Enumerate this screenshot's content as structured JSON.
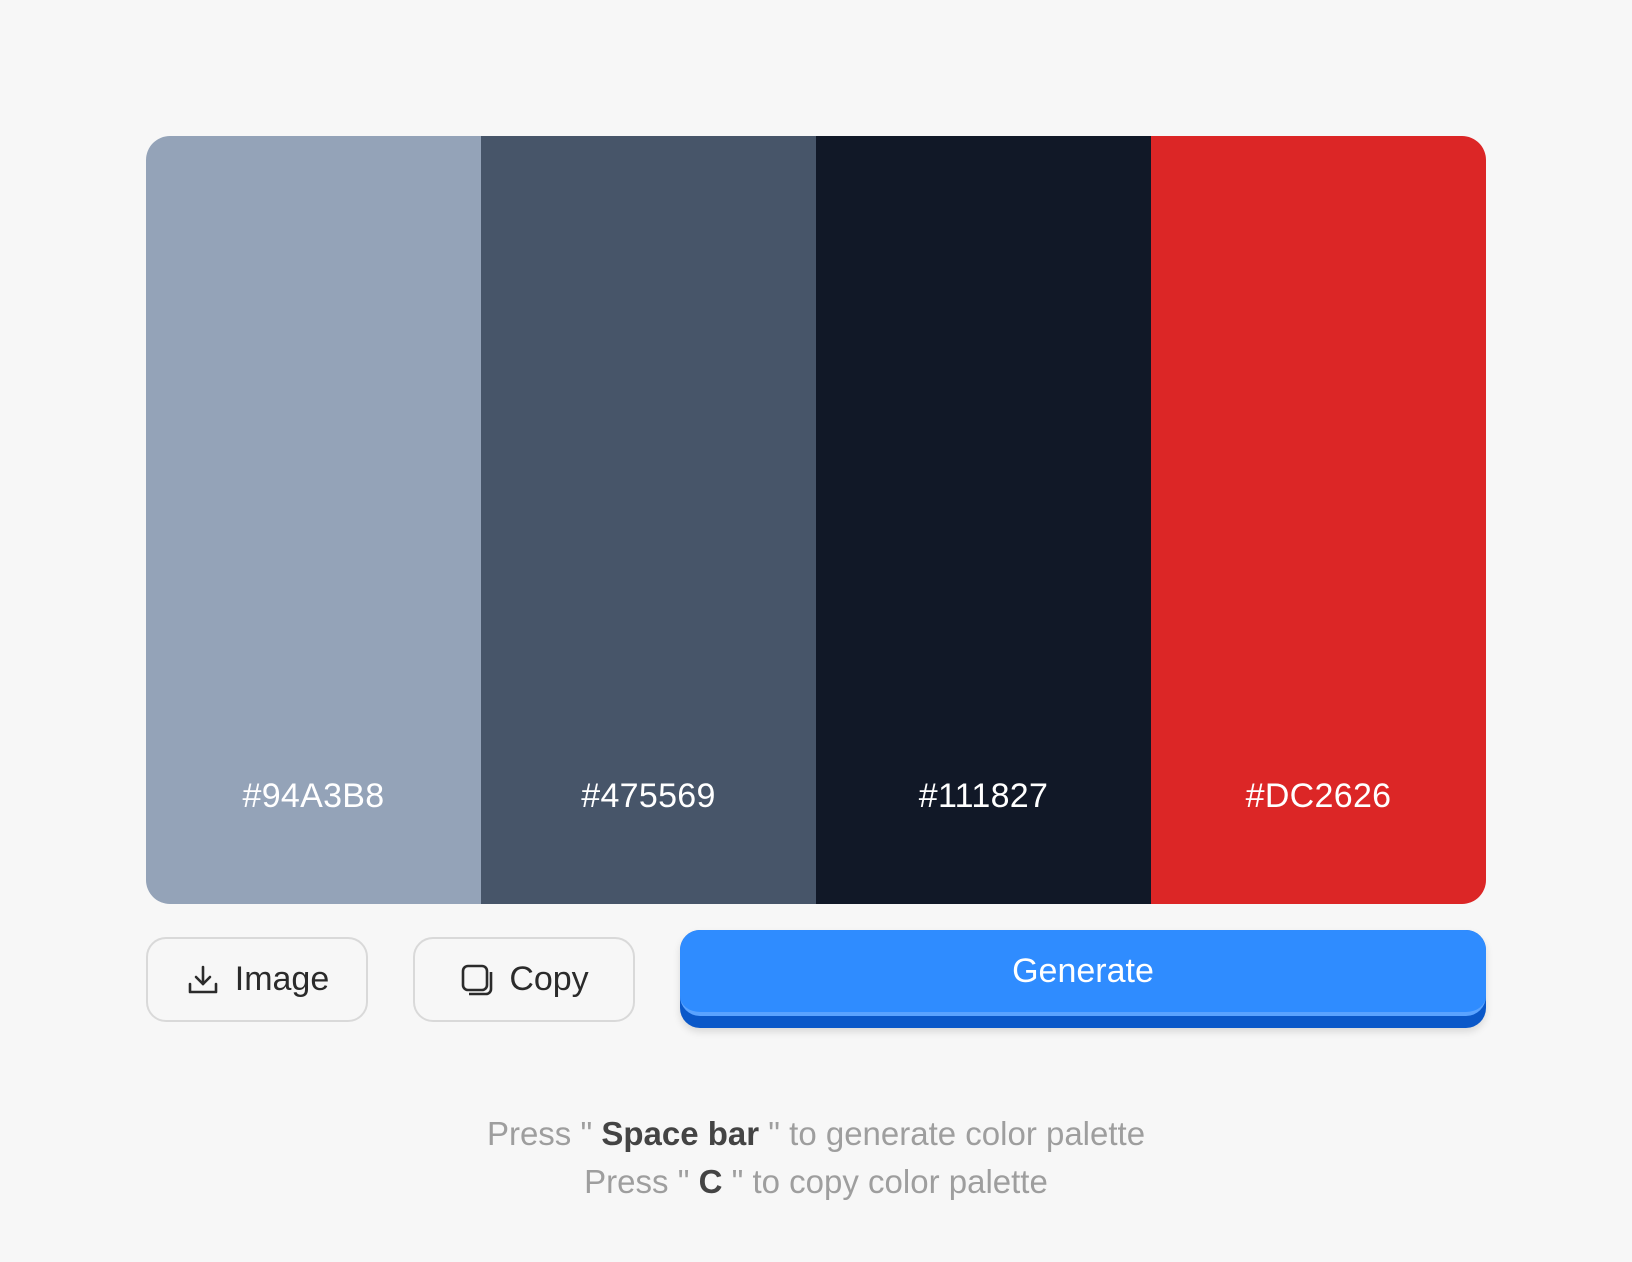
{
  "palette": {
    "colors": [
      {
        "hex": "#94A3B8",
        "color": "#94A3B8"
      },
      {
        "hex": "#475569",
        "color": "#475569"
      },
      {
        "hex": "#111827",
        "color": "#111827"
      },
      {
        "hex": "#DC2626",
        "color": "#DC2626"
      }
    ]
  },
  "buttons": {
    "image_label": "Image",
    "image_icon": "download-icon",
    "copy_label": "Copy",
    "copy_icon": "copy-icon",
    "generate_label": "Generate",
    "generate_color": "#2F8CFF"
  },
  "hints": {
    "line1": {
      "prefix": "Press \" ",
      "key": "Space bar",
      "suffix": " \" to generate color palette"
    },
    "line2": {
      "prefix": "Press \" ",
      "key": "C",
      "suffix": " \" to copy color palette"
    }
  }
}
